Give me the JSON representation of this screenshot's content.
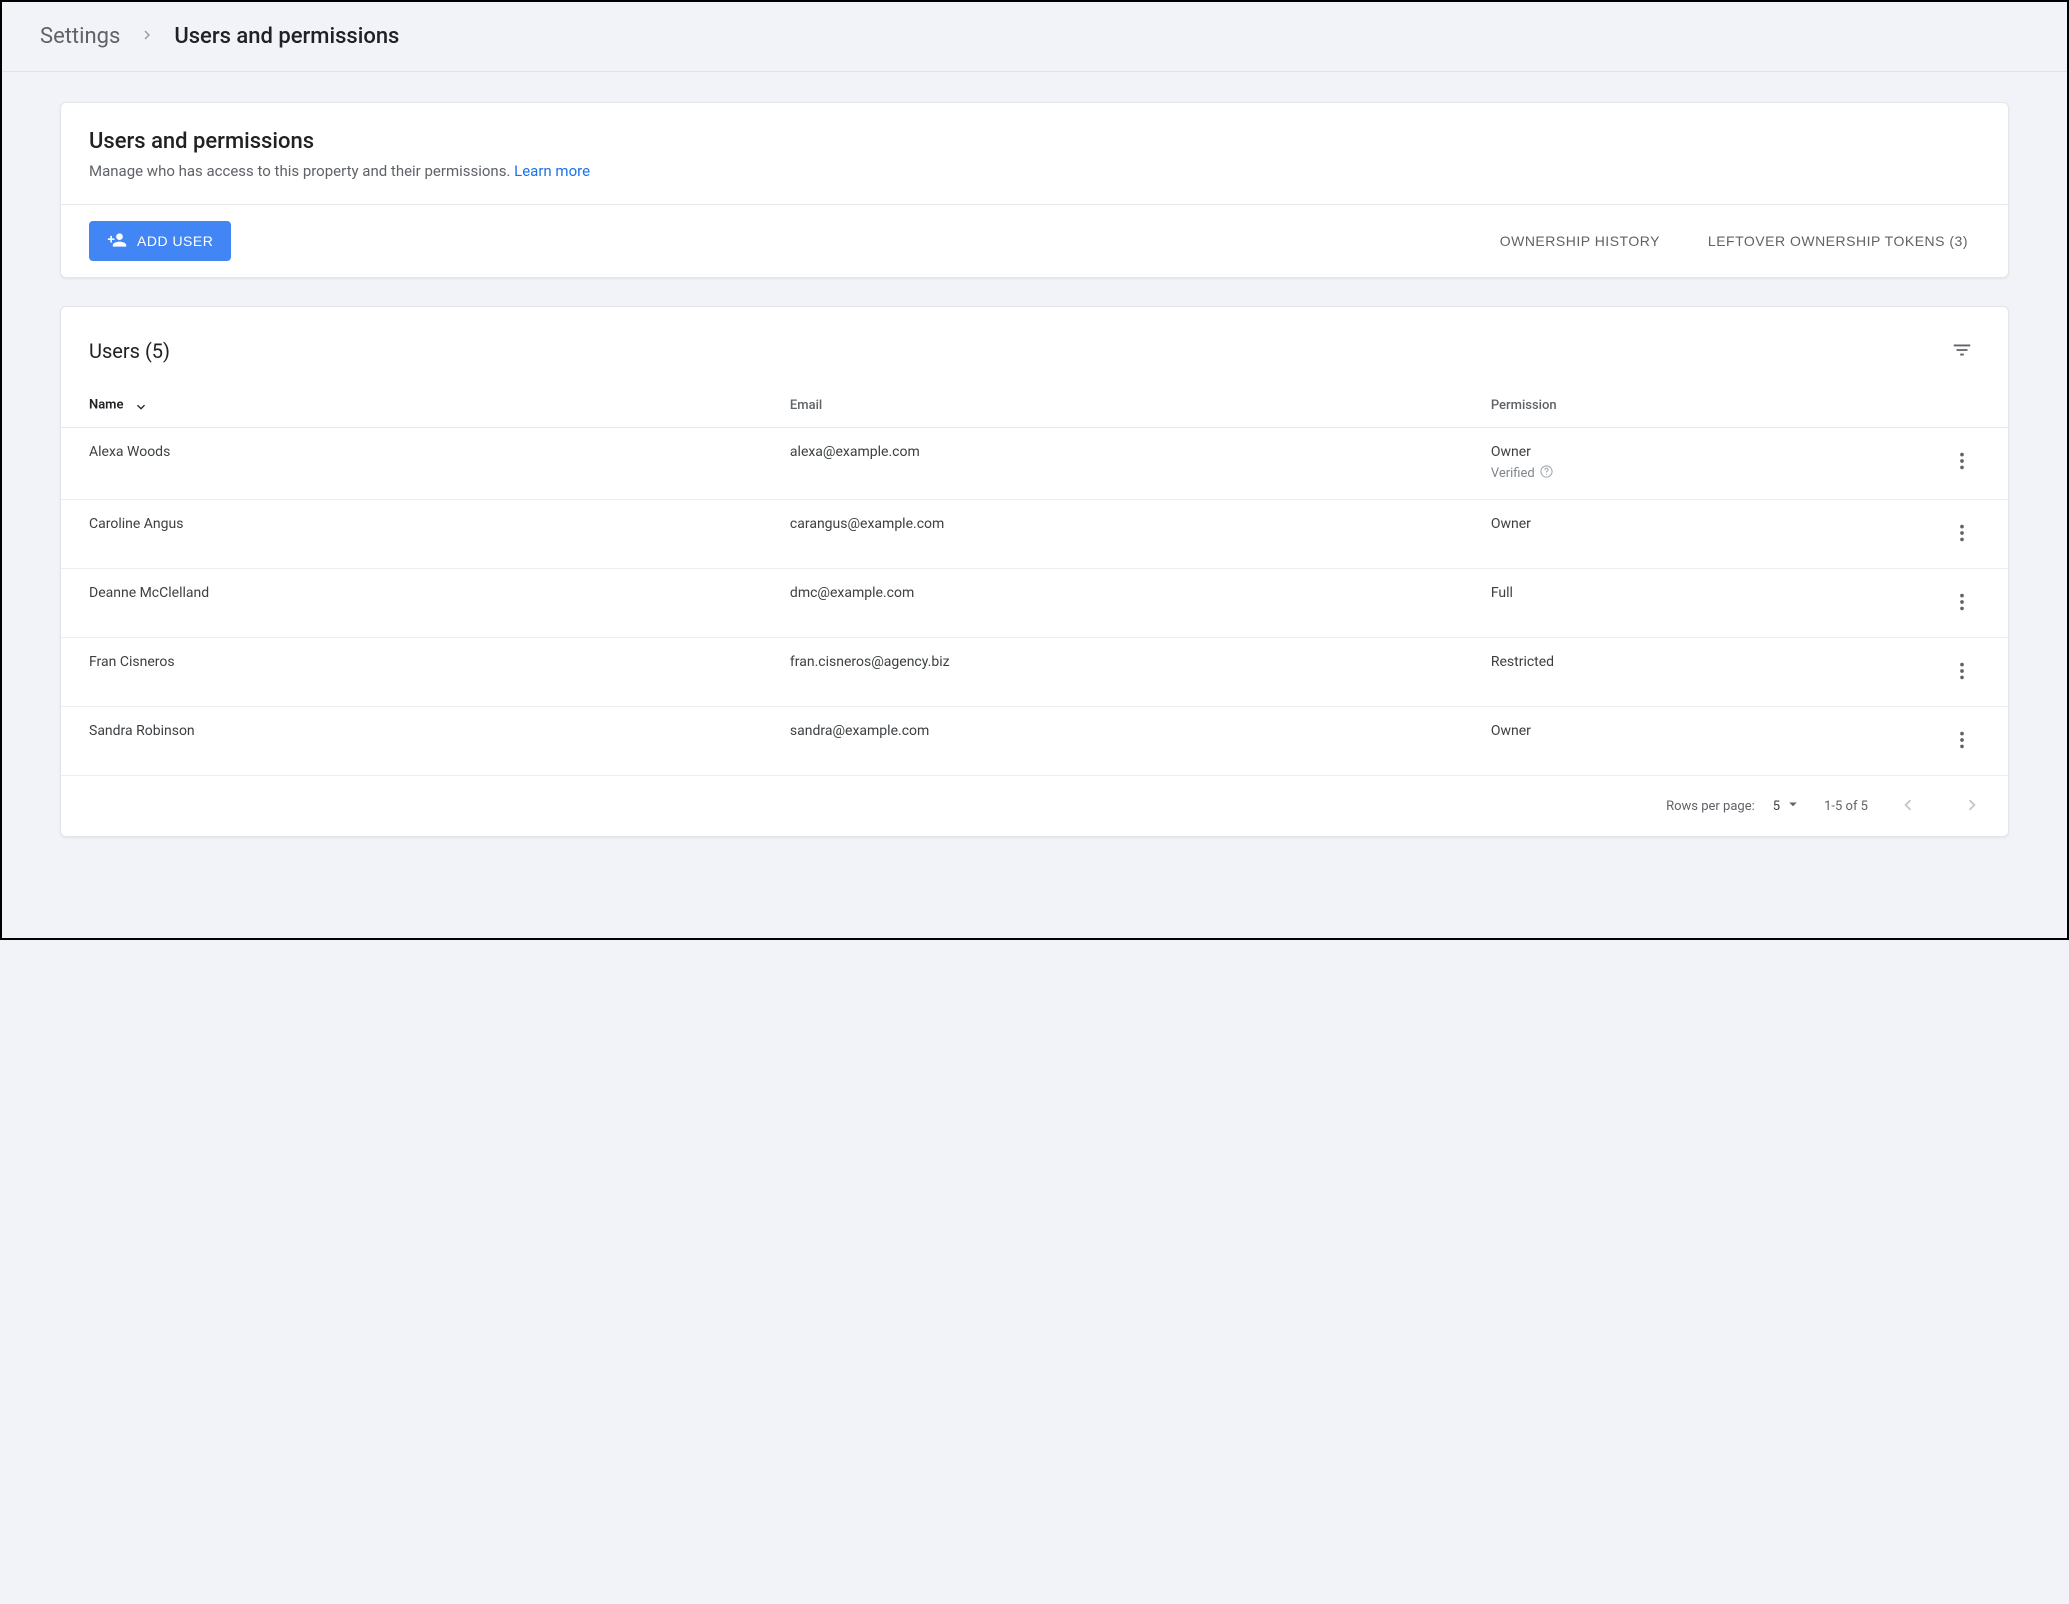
{
  "breadcrumb": {
    "root": "Settings",
    "current": "Users and permissions"
  },
  "header_card": {
    "title": "Users and permissions",
    "subtitle_pre": "Manage who has access to this property and their permissions. ",
    "learn_more": "Learn more"
  },
  "toolbar": {
    "add_user": "ADD USER",
    "ownership_history": "OWNERSHIP HISTORY",
    "leftover_tokens": "LEFTOVER OWNERSHIP TOKENS (3)"
  },
  "users_section": {
    "heading": "Users (5)",
    "columns": {
      "name": "Name",
      "email": "Email",
      "permission": "Permission"
    },
    "verified_label": "Verified",
    "users": [
      {
        "name": "Alexa Woods",
        "email": "alexa@example.com",
        "permission": "Owner",
        "verified": true
      },
      {
        "name": "Caroline Angus",
        "email": "carangus@example.com",
        "permission": "Owner",
        "verified": false
      },
      {
        "name": "Deanne McClelland",
        "email": "dmc@example.com",
        "permission": "Full",
        "verified": false
      },
      {
        "name": "Fran Cisneros",
        "email": "fran.cisneros@agency.biz",
        "permission": "Restricted",
        "verified": false
      },
      {
        "name": "Sandra Robinson",
        "email": "sandra@example.com",
        "permission": "Owner",
        "verified": false
      }
    ]
  },
  "pagination": {
    "rows_label": "Rows per page:",
    "rows_per_page": "5",
    "range": "1-5 of 5"
  }
}
